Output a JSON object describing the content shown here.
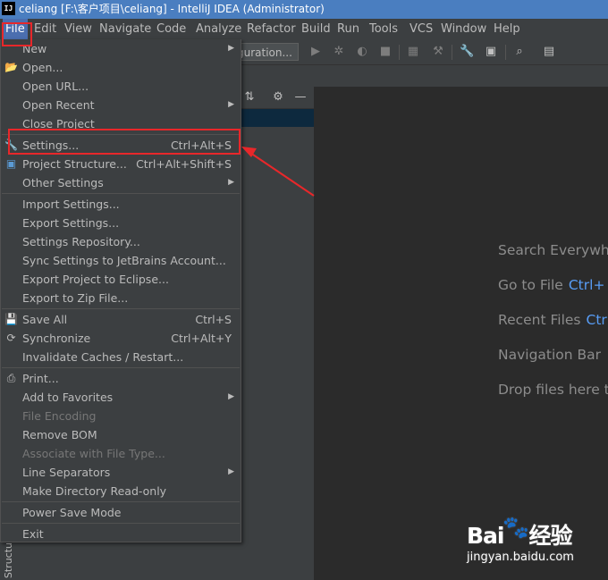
{
  "window": {
    "app_icon_text": "IJ",
    "title": "celiang [F:\\客户项目\\celiang] - IntelliJ IDEA (Administrator)"
  },
  "menubar": {
    "items": [
      "File",
      "Edit",
      "View",
      "Navigate",
      "Code",
      "Analyze",
      "Refactor",
      "Build",
      "Run",
      "Tools",
      "VCS",
      "Window",
      "Help"
    ],
    "active": "File"
  },
  "toolbar": {
    "run_config_label": "guration..."
  },
  "left_stripe": {
    "structure_label": "Structu"
  },
  "file_menu": {
    "items": [
      {
        "label": "New",
        "submenu": true
      },
      {
        "label": "Open...",
        "icon": "folder-open-icon"
      },
      {
        "label": "Open URL..."
      },
      {
        "label": "Open Recent",
        "submenu": true
      },
      {
        "label": "Close Project"
      },
      {
        "label": "Settings...",
        "shortcut": "Ctrl+Alt+S",
        "icon": "wrench-icon"
      },
      {
        "label": "Project Structure...",
        "shortcut": "Ctrl+Alt+Shift+S",
        "icon": "project-structure-icon"
      },
      {
        "label": "Other Settings",
        "submenu": true
      },
      {
        "label": "Import Settings..."
      },
      {
        "label": "Export Settings..."
      },
      {
        "label": "Settings Repository..."
      },
      {
        "label": "Sync Settings to JetBrains Account..."
      },
      {
        "label": "Export Project to Eclipse..."
      },
      {
        "label": "Export to Zip File..."
      },
      {
        "label": "Save All",
        "shortcut": "Ctrl+S",
        "icon": "save-icon"
      },
      {
        "label": "Synchronize",
        "shortcut": "Ctrl+Alt+Y",
        "icon": "sync-icon"
      },
      {
        "label": "Invalidate Caches / Restart..."
      },
      {
        "label": "Print...",
        "icon": "print-icon"
      },
      {
        "label": "Add to Favorites",
        "submenu": true
      },
      {
        "label": "File Encoding",
        "disabled": true
      },
      {
        "label": "Remove BOM"
      },
      {
        "label": "Associate with File Type...",
        "disabled": true
      },
      {
        "label": "Line Separators",
        "submenu": true
      },
      {
        "label": "Make Directory Read-only"
      },
      {
        "label": "Power Save Mode"
      },
      {
        "label": "Exit"
      }
    ]
  },
  "editor_hints": [
    {
      "text": "Search Everywhe",
      "shortcut": ""
    },
    {
      "text": "Go to File",
      "shortcut": "Ctrl+"
    },
    {
      "text": "Recent Files",
      "shortcut": "Ctr"
    },
    {
      "text": "Navigation Bar",
      "shortcut": ""
    },
    {
      "text": "Drop files here t",
      "shortcut": ""
    }
  ],
  "watermark": {
    "brand": "Bai",
    "brand_suffix": "经验",
    "url": "jingyan.baidu.com"
  },
  "colors": {
    "title_bar": "#4a7ec0",
    "menu_bg": "#3c3f41",
    "editor_bg": "#2b2b2b",
    "selection": "#4b6eaf",
    "annotation_red": "#e8272a",
    "hint_shortcut": "#589df6"
  }
}
